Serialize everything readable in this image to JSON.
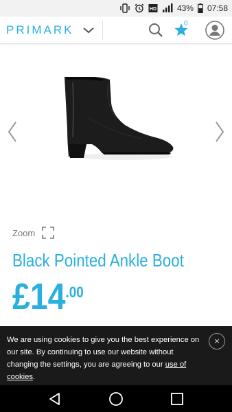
{
  "status_bar": {
    "battery": "43%",
    "time": "07:58"
  },
  "header": {
    "logo": "PRIMARK",
    "wishlist_count": "0",
    "brand_color": "#2ab0dc"
  },
  "zoom": {
    "label": "Zoom"
  },
  "product": {
    "title": "Black Pointed Ankle Boot",
    "price_main": "£14",
    "price_decimals": ".00"
  },
  "cookie": {
    "text": "We are using cookies to give you the best experience on our site. By continuing to use our website without changing the settings, you are agreeing to our ",
    "link": "use of cookies",
    "suffix": ".",
    "close": "×"
  },
  "icons": [
    "vibrate-icon",
    "alarm-icon",
    "hd-icon",
    "signal-icon",
    "battery-icon",
    "chevron-down-icon",
    "search-icon",
    "star-icon",
    "account-icon",
    "chevron-left-icon",
    "chevron-right-icon",
    "zoom-icon",
    "close-icon",
    "back-icon",
    "home-icon",
    "recent-apps-icon"
  ]
}
